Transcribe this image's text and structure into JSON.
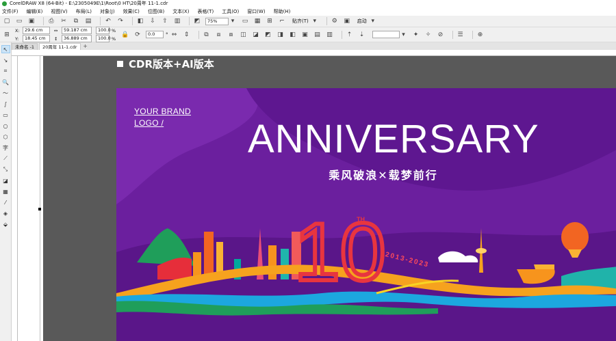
{
  "window": {
    "title": "CorelDRAW X8 (64-Bit) - E:\\2305049E\\1\\Root\\0 HT\\20周年 11-1.cdr"
  },
  "menu": [
    "文件(F)",
    "编辑(E)",
    "视图(V)",
    "布局(L)",
    "对象(J)",
    "效果(C)",
    "位图(B)",
    "文本(X)",
    "表格(T)",
    "工具(O)",
    "窗口(W)",
    "帮助(H)"
  ],
  "toolbar_standard": {
    "zoom": "75%",
    "snap_label": "贴齐(T)",
    "launch_label": "启动"
  },
  "property_bar": {
    "x_label": "X:",
    "x_value": "29.6 cm",
    "y_label": "Y:",
    "y_value": "18.45 cm",
    "width_value": "59.187 cm",
    "height_value": "36.889 cm",
    "scale_x": "100.0",
    "scale_y": "100.0",
    "percent": "%",
    "rotation": "0.0",
    "degree": "°"
  },
  "tabs": [
    {
      "label": "未命名 -1",
      "active": false
    },
    {
      "label": "20周年 11-1.cdr",
      "active": true
    }
  ],
  "tab_add": "+",
  "canvas": {
    "caption": "CDR版本+AI版本"
  },
  "poster": {
    "brand_line1": "YOUR BRAND",
    "brand_line2": "LOGO /",
    "headline": "ANNIVERSARY",
    "slogan": "乘风破浪✕载梦前行",
    "number": "10",
    "suffix": "TH",
    "years": "2013-2023"
  },
  "colors": {
    "poster_bg": "#6b1f9e",
    "accent_red": "#e8353f",
    "pasteboard": "#595959"
  }
}
